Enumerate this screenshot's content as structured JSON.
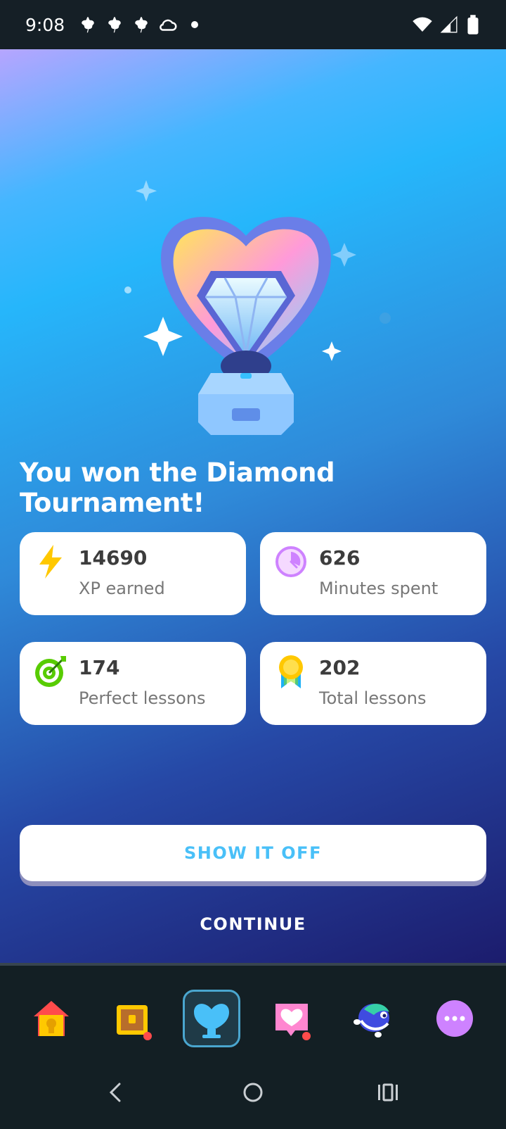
{
  "status_bar": {
    "time": "9:08",
    "notification_icons": [
      "leaf-icon",
      "leaf-icon",
      "leaf-icon",
      "cloud-icon",
      "dot-icon"
    ],
    "right_icons": [
      "wifi-icon",
      "signal-icon",
      "battery-icon"
    ]
  },
  "main": {
    "title": "You won the Diamond Tournament!",
    "stats": [
      {
        "value": "14690",
        "label": "XP earned",
        "icon": "lightning-icon"
      },
      {
        "value": "626",
        "label": "Minutes spent",
        "icon": "clock-icon"
      },
      {
        "value": "174",
        "label": "Perfect lessons",
        "icon": "target-icon"
      },
      {
        "value": "202",
        "label": "Total lessons",
        "icon": "medal-icon"
      }
    ],
    "show_button": "SHOW IT OFF",
    "continue_button": "CONTINUE"
  },
  "tab_bar": {
    "tabs": [
      "home-icon",
      "treasure-chest-icon",
      "trophy-icon",
      "heart-message-icon",
      "bird-icon",
      "more-icon"
    ],
    "active_tab": "trophy-icon"
  },
  "nav_bar": {
    "buttons": [
      "back-icon",
      "home-circle-icon",
      "recents-icon"
    ]
  },
  "colors": {
    "accent": "#49c0f8",
    "card_text": "#3c3c3c",
    "card_label": "#777777",
    "tab_active_border": "#4aa6cf"
  }
}
